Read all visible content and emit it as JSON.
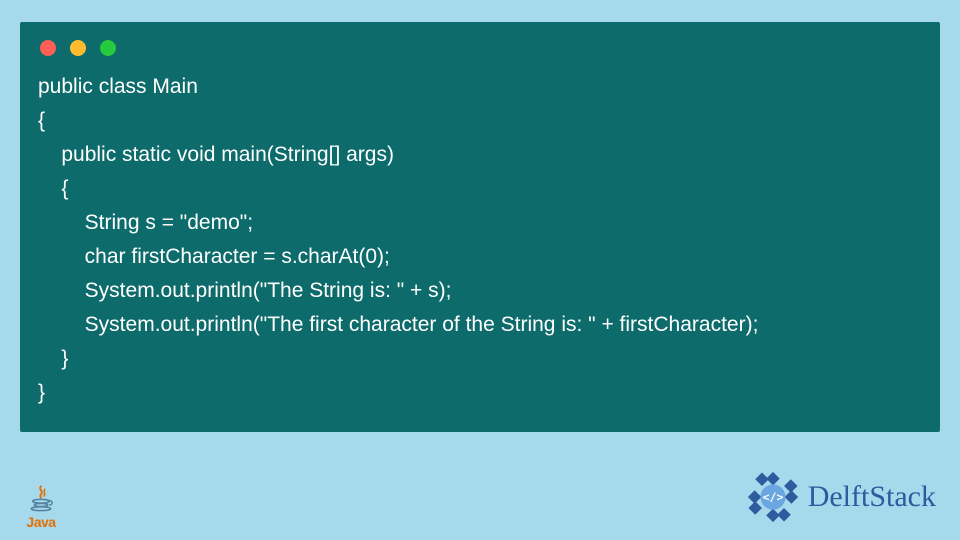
{
  "code": {
    "lines": [
      "public class Main",
      "{",
      "    public static void main(String[] args)",
      "    {",
      "        String s = \"demo\";",
      "        char firstCharacter = s.charAt(0);",
      "        System.out.println(\"The String is: \" + s);",
      "        System.out.println(\"The first character of the String is: \" + firstCharacter);",
      "    }",
      "}"
    ]
  },
  "footer": {
    "java_label": "Java",
    "brand_label": "DelftStack"
  },
  "colors": {
    "page_bg": "#a5d9eb",
    "window_bg": "#0d6b6b",
    "code_fg": "#ffffff",
    "brand_fg": "#2e5b9e",
    "java_orange": "#e76f00",
    "java_blue": "#5382a1"
  }
}
